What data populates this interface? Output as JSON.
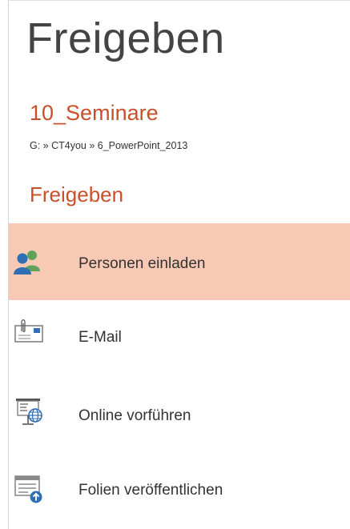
{
  "header": {
    "title": "Freigeben"
  },
  "document": {
    "name": "10_Seminare",
    "path": "G: » CT4you » 6_PowerPoint_2013"
  },
  "share_section": {
    "heading": "Freigeben",
    "items": [
      {
        "label": "Personen einladen",
        "icon": "invite-people-icon",
        "selected": true
      },
      {
        "label": "E-Mail",
        "icon": "email-attachment-icon",
        "selected": false
      },
      {
        "label": "Online vorführen",
        "icon": "present-online-icon",
        "selected": false
      },
      {
        "label": "Folien veröffentlichen",
        "icon": "publish-slides-icon",
        "selected": false
      }
    ]
  },
  "colors": {
    "accent": "#c8502a",
    "selection": "#f8c9b4",
    "text": "#333333",
    "title": "#444444"
  }
}
